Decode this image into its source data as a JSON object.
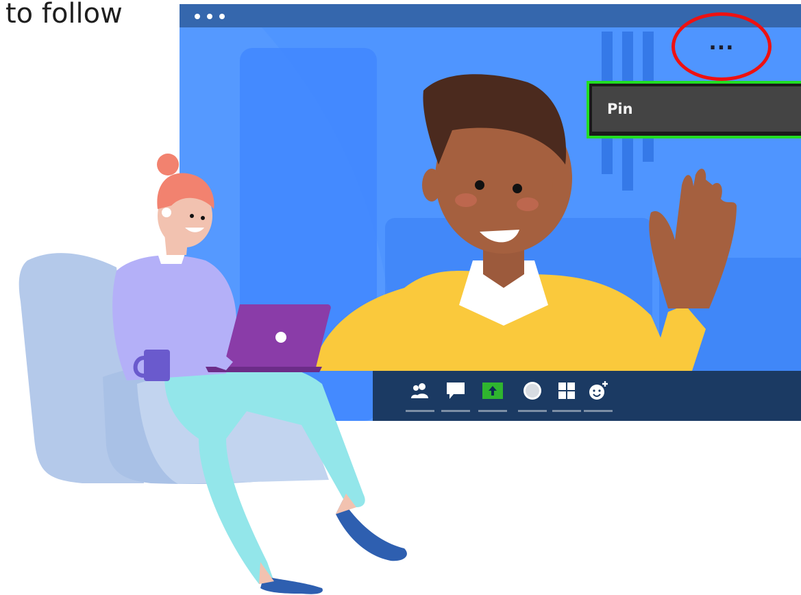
{
  "caption": "to follow",
  "window": {
    "more_options_label": "...",
    "menu": {
      "pin_label": "Pin"
    }
  },
  "toolbar": {
    "buttons": [
      {
        "name": "participants-icon"
      },
      {
        "name": "chat-icon"
      },
      {
        "name": "share-screen-icon"
      },
      {
        "name": "record-icon"
      },
      {
        "name": "view-layout-icon"
      },
      {
        "name": "reactions-icon"
      }
    ]
  },
  "colors": {
    "window_bg": "#4f95ff",
    "titlebar": "#3567ad",
    "toolbar": "#1b3a63",
    "highlight_red": "#ee1111",
    "highlight_green": "#22dd22",
    "share_green": "#2fb52f"
  }
}
